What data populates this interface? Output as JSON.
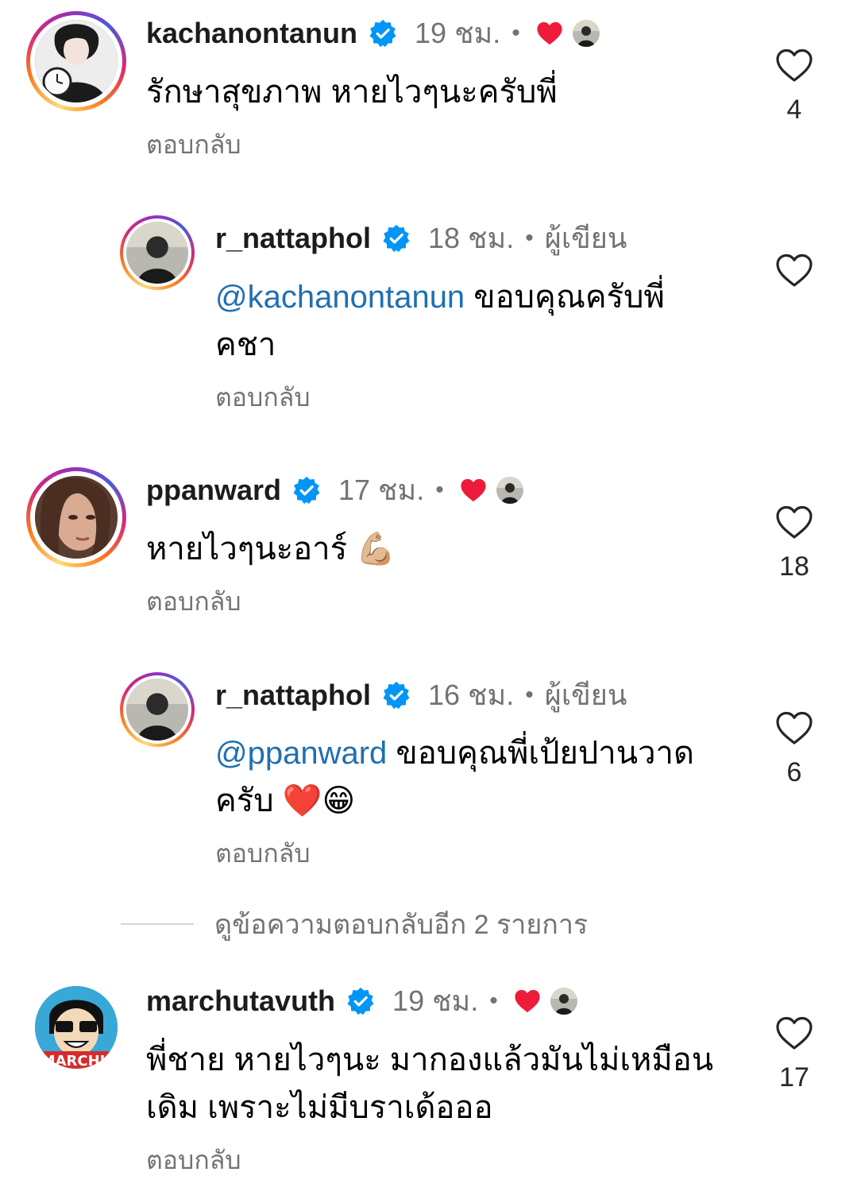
{
  "comments": [
    {
      "username": "kachanontanun",
      "time": "19 ชม.",
      "dot": "•",
      "text": "รักษาสุขภาพ หายไวๆนะครับพี่",
      "reply_label": "ตอบกลับ",
      "likes": "4",
      "liked_by_author": true
    },
    {
      "username": "r_nattaphol",
      "time": "18 ชม.",
      "dot": "•",
      "author_label": "ผู้เขียน",
      "mention": "@kachanontanun",
      "text_line1": " ขอบคุณครับพี่",
      "text_line2": "คชา",
      "reply_label": "ตอบกลับ",
      "likes": ""
    },
    {
      "username": "ppanward",
      "time": "17 ชม.",
      "dot": "•",
      "text": "หายไวๆนะอาร์ 💪🏼",
      "reply_label": "ตอบกลับ",
      "likes": "18",
      "liked_by_author": true
    },
    {
      "username": "r_nattaphol",
      "time": "16 ชม.",
      "dot": "•",
      "author_label": "ผู้เขียน",
      "mention": "@ppanward",
      "text_line1": " ขอบคุณพี่เป้ยปานวาด",
      "text_line2": "ครับ ❤️😁",
      "reply_label": "ตอบกลับ",
      "likes": "6"
    },
    {
      "username": "marchutavuth",
      "time": "19 ชม.",
      "dot": "•",
      "text_line1": "พี่ชาย หายไวๆนะ มากองแล้วมันไม่เหมือน",
      "text_line2": "เดิม เพราะไม่มีบราเด้อออ",
      "reply_label": "ตอบกลับ",
      "likes": "17",
      "liked_by_author": true
    }
  ],
  "view_more_replies": "ดูข้อความตอบกลับอีก 2 รายการ",
  "colors": {
    "verified": "#0095f6",
    "heart": "#ed1c3a",
    "mention": "#1f6fb2",
    "secondary_text": "#737373"
  },
  "icons": [
    "verified-badge-icon",
    "heart-filled-icon",
    "heart-outline-icon"
  ]
}
